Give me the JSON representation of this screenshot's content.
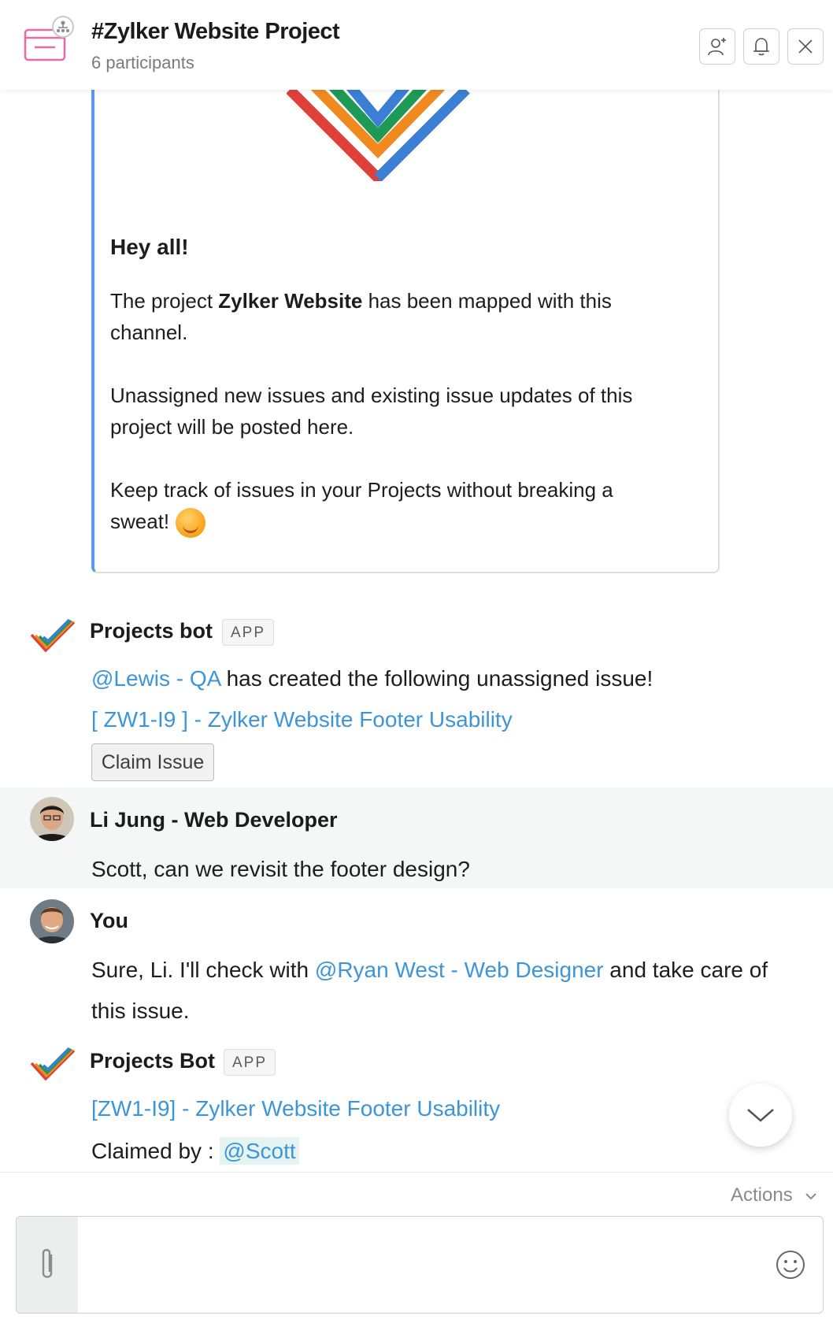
{
  "header": {
    "title": "#Zylker Website Project",
    "subtitle": "6 participants"
  },
  "welcome_card": {
    "greeting": "Hey all!",
    "p1_prefix": "The project ",
    "p1_bold": "Zylker Website",
    "p1_suffix": "  has been mapped with this channel.",
    "p2": "Unassigned new issues and existing issue updates of this project will be posted here.",
    "p3": "Keep track of issues in your Projects without breaking a sweat!"
  },
  "messages": [
    {
      "sender": "Projects bot",
      "badge": "APP",
      "mention": "@Lewis - QA",
      "text": " has created the following unassigned issue!",
      "issue_link": " [ ZW1-I9 ] - Zylker Website Footer Usability",
      "button": "Claim Issue"
    },
    {
      "sender": "Li Jung  - Web Developer",
      "text": "Scott, can we revisit the footer design?"
    },
    {
      "sender": "You",
      "text_a": "Sure, Li. I'll check with ",
      "mention": "@Ryan West - Web Designer",
      "text_b": " and take care of",
      "text_c": "this issue."
    },
    {
      "sender": "Projects Bot",
      "badge": "APP",
      "issue_link": "[ZW1-I9] - Zylker Website Footer Usability",
      "claimed_label": "Claimed by : ",
      "claimed_user": "@Scott"
    }
  ],
  "footer": {
    "actions_label": "Actions"
  },
  "colors": {
    "link": "#3d95d9",
    "card_accent": "#5a9de6",
    "mention_bg": "#e6f4f1"
  }
}
